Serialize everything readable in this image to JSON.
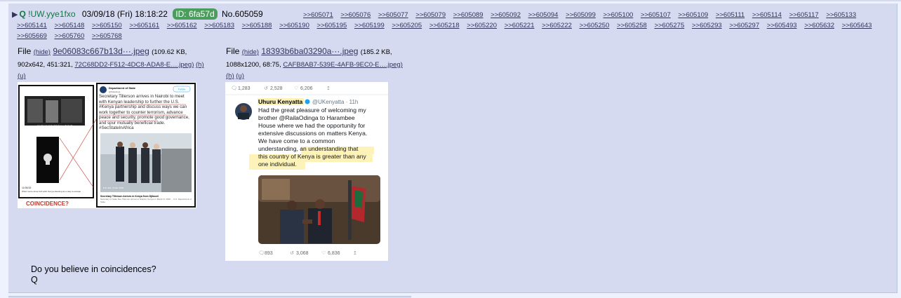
{
  "post": {
    "name": "Q",
    "tripcode": "!UW.yye1fxo",
    "date": "03/09/18 (Fri) 18:18:22",
    "id_label": "ID: 6fa57d",
    "number": "No.605059",
    "replies": [
      ">>605071",
      ">>605076",
      ">>605077",
      ">>605079",
      ">>605089",
      ">>605092",
      ">>605094",
      ">>605099",
      ">>605100",
      ">>605107",
      ">>605109",
      ">>605111",
      ">>605114",
      ">>605117",
      ">>605133",
      ">>605141",
      ">>605148",
      ">>605150",
      ">>605161",
      ">>605162",
      ">>605183",
      ">>605188",
      ">>605190",
      ">>605195",
      ">>605199",
      ">>605205",
      ">>605218",
      ">>605220",
      ">>605221",
      ">>605222",
      ">>605250",
      ">>605258",
      ">>605275",
      ">>605293",
      ">>605297",
      ">>605493",
      ">>605632",
      ">>605643",
      ">>605669",
      ">>605760",
      ">>605768"
    ],
    "comment_lines": [
      "Do you believe in coincidences?",
      "Q"
    ]
  },
  "files": [
    {
      "label": "File",
      "hide": "(hide)",
      "filename": "9e06083c667b13d···.jpeg",
      "size": "(109.62 KB,",
      "dims": "902x642, 451:321,",
      "orig": "72C68DD2-F512-4DC8-ADA8-E….jpeg)",
      "h": "(h)",
      "u": "(u)"
    },
    {
      "label": "File",
      "hide": "(hide)",
      "filename": "18393b6ba03290a···.jpeg",
      "size": "(185.2 KB,",
      "dims": "1088x1200, 68:75,",
      "orig": "CAFB8AB7-539E-4AFB-9EC0-E….jpeg)",
      "h": "(h)",
      "u": "(u)"
    }
  ],
  "image1": {
    "caption_top_1": "WHEN IN DOUBT PULL IT OUT",
    "caption_top_2": "YOU WERE NEVER EVEN HERE",
    "small_text_left_1": "11/08/18",
    "small_text_left_2": "When we're done he'll wish Kenya cleaning as a way to escape",
    "coincidence": "COINCIDENCE?",
    "account": "Department of State",
    "handle": "@StateDept",
    "follow": "Follow",
    "tweet": "Secretary Tillerson arrives in Nairobi to meet with Kenyan leadership to further the U.S. #Kenya partnership and discuss ways we can work together to counter terrorism, advance peace and security, promote good governance, and spur mutually beneficial trade. #SecStateInAfrica",
    "article_title": "Secretary Tillerson Arrives in Kenya from Djibouti",
    "article_sub": "Secretary of State Rex Tillerson arrives in Nairobi, Kenya on March 8, 2018 ... U.S. Department of State",
    "photo_meta": "8:31 AM - 8 Mar 2018"
  },
  "image2": {
    "top_stats": [
      "1,283",
      "2,528",
      "6,206"
    ],
    "name": "Uhuru Kenyatta",
    "handle": "@UKenyatta · 11h",
    "tweet_lines": [
      "Had the great pleasure of welcoming my",
      "brother @RailaOdinga to Harambee",
      "House where we had the opportunity for",
      "extensive discussions on matters Kenya.",
      "We have come to a common",
      "understanding, an understanding that",
      "this country of Kenya is greater than any",
      "one individual."
    ],
    "bottom_stats": [
      "893",
      "3,068",
      "6,836"
    ]
  },
  "colors": {
    "name_green": "#117743",
    "link": "#34345c",
    "post_bg": "#d6daf0",
    "id_bg": "#4a9d5c",
    "twitter_blue": "#1da1f2",
    "red": "#c0392b"
  }
}
